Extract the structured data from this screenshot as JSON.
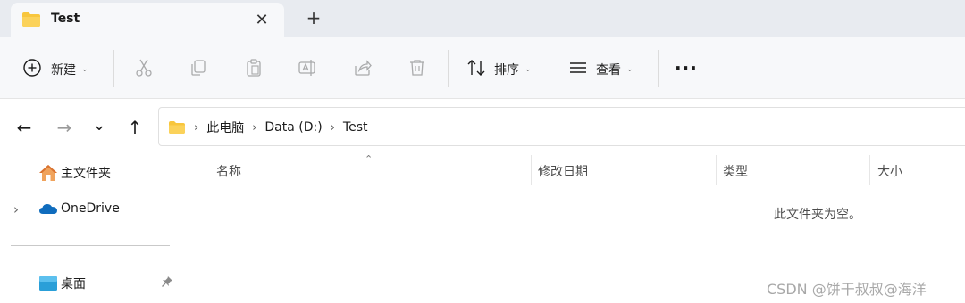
{
  "tab": {
    "title": "Test",
    "close_glyph": "✕",
    "new_tab_glyph": "+"
  },
  "toolbar": {
    "new_label": "新建",
    "sort_label": "排序",
    "view_label": "查看",
    "more_glyph": "···",
    "chevron_glyph": "⌄"
  },
  "nav": {
    "back_glyph": "←",
    "forward_glyph": "→",
    "recent_glyph": "⌄",
    "up_glyph": "↑"
  },
  "breadcrumb": {
    "separator": "›",
    "items": [
      "此电脑",
      "Data (D:)",
      "Test"
    ]
  },
  "sidebar": {
    "home_label": "主文件夹",
    "onedrive_label": "OneDrive",
    "desktop_label": "桌面",
    "expand_glyph": "›"
  },
  "columns": {
    "name": "名称",
    "modified": "修改日期",
    "type": "类型",
    "size": "大小",
    "sort_glyph": "⌃"
  },
  "main": {
    "empty_text": "此文件夹为空。",
    "watermark": "CSDN @饼干叔叔@海洋"
  },
  "colors": {
    "accent": "#0067c0",
    "folder": "#f8c63d",
    "onedrive": "#0f6cbd",
    "toolbar_bg": "#f7f8fa",
    "tabbar_bg": "#e8ebf0"
  }
}
